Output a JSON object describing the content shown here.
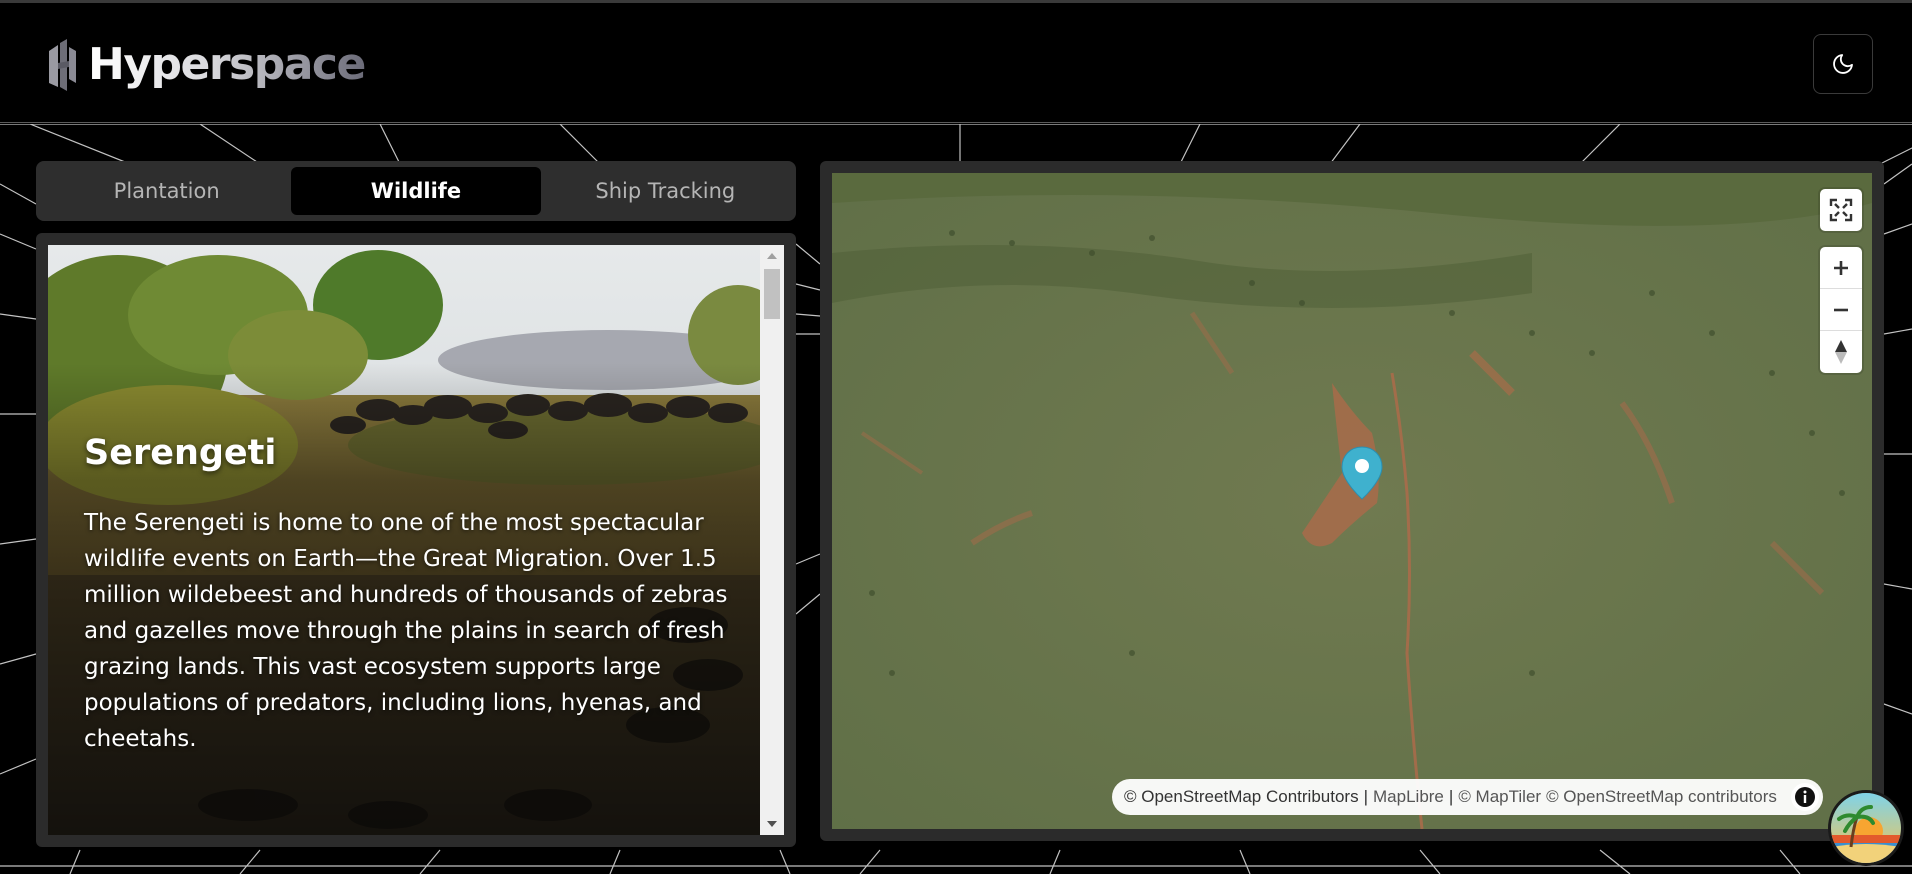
{
  "header": {
    "app_name": "Hyperspace",
    "logo_icon": "hyperspace-logo-icon",
    "theme_toggle_icon": "moon-icon"
  },
  "tabs": [
    {
      "label": "Plantation",
      "active": false
    },
    {
      "label": "Wildlife",
      "active": true
    },
    {
      "label": "Ship Tracking",
      "active": false
    }
  ],
  "location_card": {
    "title": "Serengeti",
    "description": "The Serengeti is home to one of the most spectacular wildlife events on Earth—the Great Migration. Over 1.5 million wildebeest and hundreds of thousands of zebras and gazelles move through the plains in search of fresh grazing lands. This vast ecosystem supports large populations of predators, including lions, hyenas, and cheetahs."
  },
  "map": {
    "controls": {
      "fullscreen_icon": "fullscreen-icon",
      "zoom_in_icon": "plus-icon",
      "zoom_out_icon": "minus-icon",
      "compass_icon": "compass-icon"
    },
    "marker_icon": "map-pin-icon",
    "marker_color": "#3fb1ce",
    "attribution": {
      "osm": "© OpenStreetMap Contributors",
      "sep1": "|",
      "maplibre": "MapLibre",
      "sep2": "|",
      "maptiler": "© MapTiler",
      "osm2": "© OpenStreetMap contributors"
    },
    "info_icon": "info-icon"
  },
  "floating_button_icon": "beach-sunset-icon",
  "colors": {
    "background": "#000000",
    "panel": "#2b2b2b",
    "tab_active_bg": "#000000",
    "tab_inactive_text": "#b5b5b5",
    "map_terrain": "#6a7a4e"
  }
}
